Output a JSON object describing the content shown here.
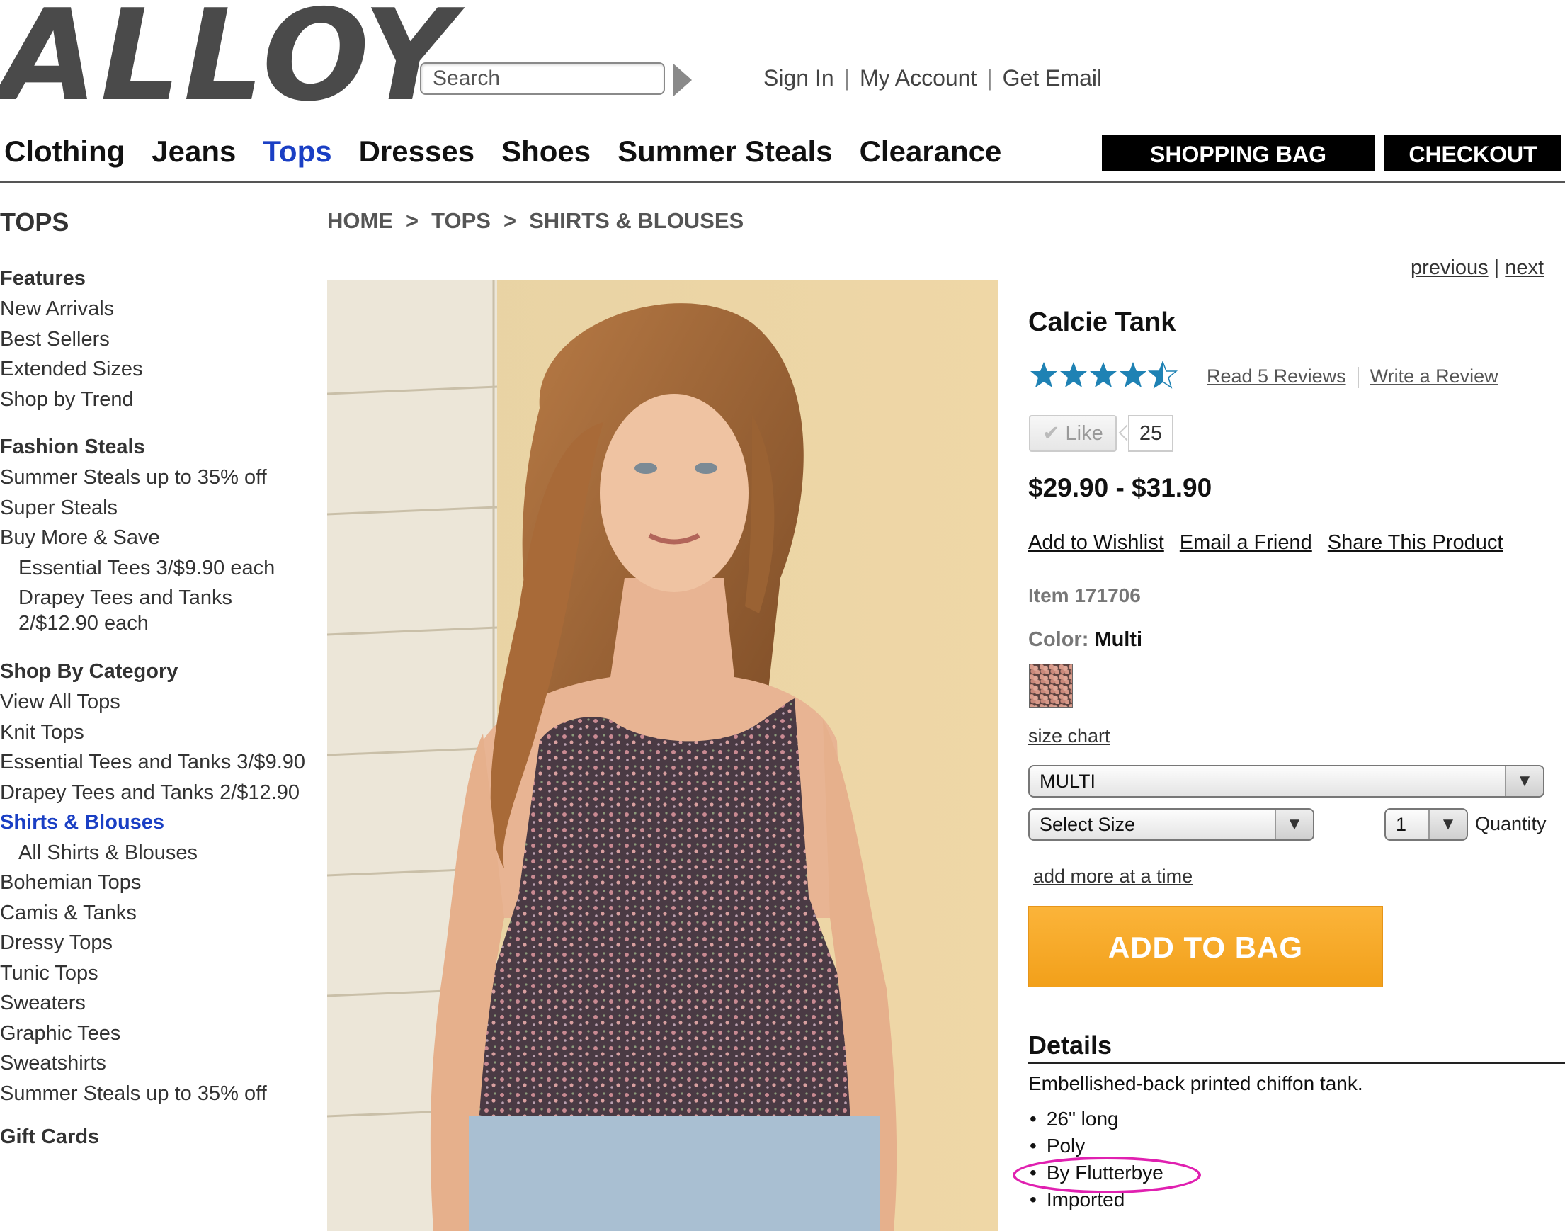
{
  "header": {
    "logo": "ALLOY",
    "search_placeholder": "Search",
    "account_links": [
      "Sign In",
      "My Account",
      "Get Email"
    ]
  },
  "nav": {
    "items": [
      "Clothing",
      "Jeans",
      "Tops",
      "Dresses",
      "Shoes",
      "Summer Steals",
      "Clearance"
    ],
    "active": "Tops",
    "shopping_bag": "SHOPPING BAG",
    "checkout": "CHECKOUT"
  },
  "sidebar": {
    "title": "TOPS",
    "features_title": "Features",
    "features": [
      "New Arrivals",
      "Best Sellers",
      "Extended Sizes",
      "Shop by Trend"
    ],
    "fashion_title": "Fashion Steals",
    "fashion": [
      "Summer Steals up to 35% off",
      "Super Steals",
      "Buy More & Save"
    ],
    "fashion_sub": [
      "Essential Tees 3/$9.90 each",
      "Drapey Tees and Tanks 2/$12.90 each"
    ],
    "category_title": "Shop By Category",
    "categories": [
      "View All Tops",
      "Knit Tops",
      "Essential Tees and Tanks 3/$9.90",
      "Drapey Tees and Tanks 2/$12.90",
      "Shirts & Blouses"
    ],
    "category_sub": [
      "All Shirts & Blouses"
    ],
    "categories_more": [
      "Bohemian Tops",
      "Camis & Tanks",
      "Dressy Tops",
      "Tunic Tops",
      "Sweaters",
      "Graphic Tees",
      "Sweatshirts",
      "Summer Steals up to 35% off"
    ],
    "gift_cards": "Gift Cards"
  },
  "breadcrumb": [
    "HOME",
    "TOPS",
    "SHIRTS & BLOUSES"
  ],
  "product": {
    "prev": "previous",
    "next": "next",
    "name": "Calcie Tank",
    "rating": 4.5,
    "rating_max": 5,
    "read_reviews": "Read 5 Reviews",
    "write_review": "Write a Review",
    "like_label": "Like",
    "like_count": "25",
    "price": "$29.90 - $31.90",
    "actions": [
      "Add to Wishlist",
      "Email a Friend",
      "Share This Product"
    ],
    "item_number": "Item 171706",
    "color_label": "Color:",
    "color_value": "Multi",
    "size_chart": "size chart",
    "color_select": "MULTI",
    "size_select": "Select Size",
    "quantity_value": "1",
    "quantity_label": "Quantity",
    "add_more": "add more at a time",
    "add_to_bag": "ADD TO BAG",
    "details_title": "Details",
    "details_desc": "Embellished-back printed chiffon tank.",
    "details_list": [
      "26\" long",
      "Poly",
      "By Flutterbye",
      "Imported"
    ]
  },
  "colors": {
    "accent_blue": "#1a3fc4",
    "star_blue": "#1f82b4",
    "add_to_bag_orange": "#f5a623",
    "highlight_magenta": "#e020b0"
  }
}
